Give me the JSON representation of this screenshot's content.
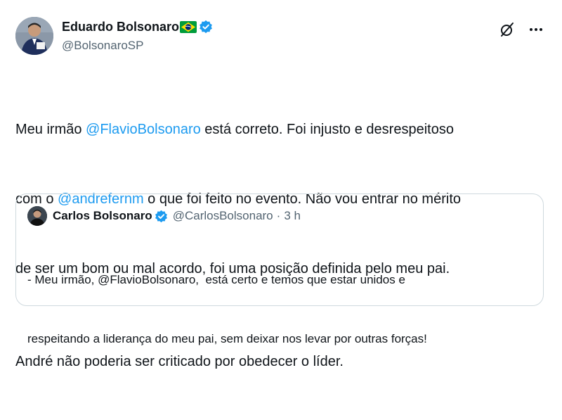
{
  "author": {
    "name": "Eduardo Bolsonaro",
    "handle": "@BolsonaroSP"
  },
  "body": {
    "line1_pre": "Meu irmão ",
    "mention1": "@FlavioBolsonaro",
    "line1_post": " está correto. Foi injusto e desrespeitoso",
    "line2_pre": "com o ",
    "mention2": "@andrefernm",
    "line2_post": " o que foi feito no evento. Não vou entrar no mérito",
    "line3": "de ser um bom ou mal acordo, foi uma posição definida pelo meu pai.",
    "paragraph2": "André não poderia ser criticado por obedecer o líder."
  },
  "quote": {
    "name": "Carlos Bolsonaro",
    "handle": "@CarlosBolsonaro",
    "separator": "·",
    "time": "3 h",
    "line1": "- Meu irmão, @FlavioBolsonaro,  está certo e temos que estar unidos e",
    "line2": "respeitando a liderança do meu pai, sem deixar nos levar por outras forças!"
  },
  "icons": {
    "verified": "verified-badge-icon",
    "flag": "brazil-flag-icon",
    "grok": "grok-icon",
    "more": "more-icon"
  },
  "colors": {
    "link": "#1d9bf0",
    "secondary_text": "#536471",
    "text": "#0f1419",
    "border": "#cfd9de"
  }
}
